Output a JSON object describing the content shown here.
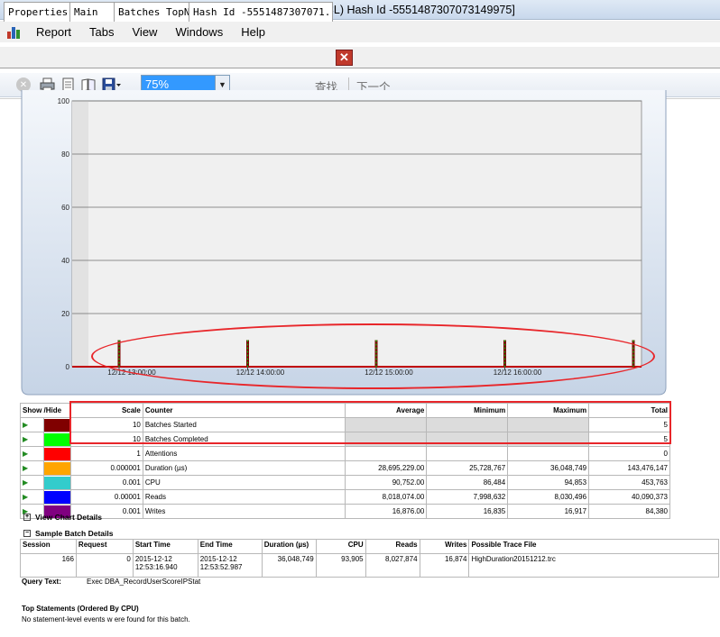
{
  "window": {
    "title": "Reporter - [(Server: 127.0.0.1,7777 Database: PerfAnalysis_CL) Hash Id -5551487307073149975]"
  },
  "menu": {
    "items": [
      "Report",
      "Tabs",
      "View",
      "Windows",
      "Help"
    ]
  },
  "tabs": [
    "Properties",
    "Main",
    "Batches TopN",
    "Hash Id -5551487307071.."
  ],
  "toolbar": {
    "zoom": "75%",
    "find_label": "查找",
    "next_label": "下一个"
  },
  "chart_data": {
    "type": "bar",
    "yticks": [
      "100",
      "80",
      "60",
      "40",
      "20",
      "0"
    ],
    "ylim": [
      0,
      100
    ],
    "x_tick_labels": [
      "12/12 13:00:00",
      "12/12 14:00:00",
      "12/12 15:00:00",
      "12/12 16:00:00"
    ],
    "series": [
      {
        "name": "Batches Started",
        "color": "#800000",
        "values": [
          10,
          10,
          10,
          10,
          10
        ]
      },
      {
        "name": "Batches Completed",
        "color": "#00cc00",
        "values": [
          10,
          10,
          10,
          10,
          10
        ]
      }
    ],
    "x_positions_hours": [
      13.0,
      14.0,
      15.0,
      16.0,
      17.0
    ],
    "grid": true
  },
  "counters": {
    "headers": [
      "Show /Hide",
      "Scale",
      "Counter",
      "Average",
      "Minimum",
      "Maximum",
      "Total"
    ],
    "rows": [
      {
        "color": "#800000",
        "scale": "10",
        "counter": "Batches Started",
        "average": "",
        "minimum": "",
        "maximum": "",
        "total": "5",
        "shaded": true
      },
      {
        "color": "#00ff00",
        "scale": "10",
        "counter": "Batches Completed",
        "average": "",
        "minimum": "",
        "maximum": "",
        "total": "5",
        "shaded": true
      },
      {
        "color": "#ff0000",
        "scale": "1",
        "counter": "Attentions",
        "average": "",
        "minimum": "",
        "maximum": "",
        "total": "0",
        "shaded": false
      },
      {
        "color": "#ffa500",
        "scale": "0.000001",
        "counter": "Duration (µs)",
        "average": "28,695,229.00",
        "minimum": "25,728,767",
        "maximum": "36,048,749",
        "total": "143,476,147",
        "shaded": false
      },
      {
        "color": "#33cccc",
        "scale": "0.001",
        "counter": "CPU",
        "average": "90,752.00",
        "minimum": "86,484",
        "maximum": "94,853",
        "total": "453,763",
        "shaded": false
      },
      {
        "color": "#0000ff",
        "scale": "0.00001",
        "counter": "Reads",
        "average": "8,018,074.00",
        "minimum": "7,998,632",
        "maximum": "8,030,496",
        "total": "40,090,373",
        "shaded": false
      },
      {
        "color": "#800080",
        "scale": "0.001",
        "counter": "Writes",
        "average": "16,876.00",
        "minimum": "16,835",
        "maximum": "16,917",
        "total": "84,380",
        "shaded": false
      }
    ]
  },
  "sections": {
    "view_chart": "View Chart Details",
    "sample_batch": "Sample Batch Details"
  },
  "batch": {
    "headers": [
      "Session",
      "Request",
      "Start Time",
      "End Time",
      "Duration (µs)",
      "CPU",
      "Reads",
      "Writes",
      "Possible Trace File"
    ],
    "row": [
      "166",
      "0",
      "2015-12-12 12:53:16.940",
      "2015-12-12 12:53:52.987",
      "36,048,749",
      "93,905",
      "8,027,874",
      "16,874",
      "HighDuration20151212.trc"
    ]
  },
  "query": {
    "label": "Query Text:",
    "value": "Exec DBA_RecordUserScoreIPStat"
  },
  "top_statements": {
    "title": "Top Statements (Ordered By CPU)",
    "message": "No statement-level events w ere found for this batch."
  }
}
